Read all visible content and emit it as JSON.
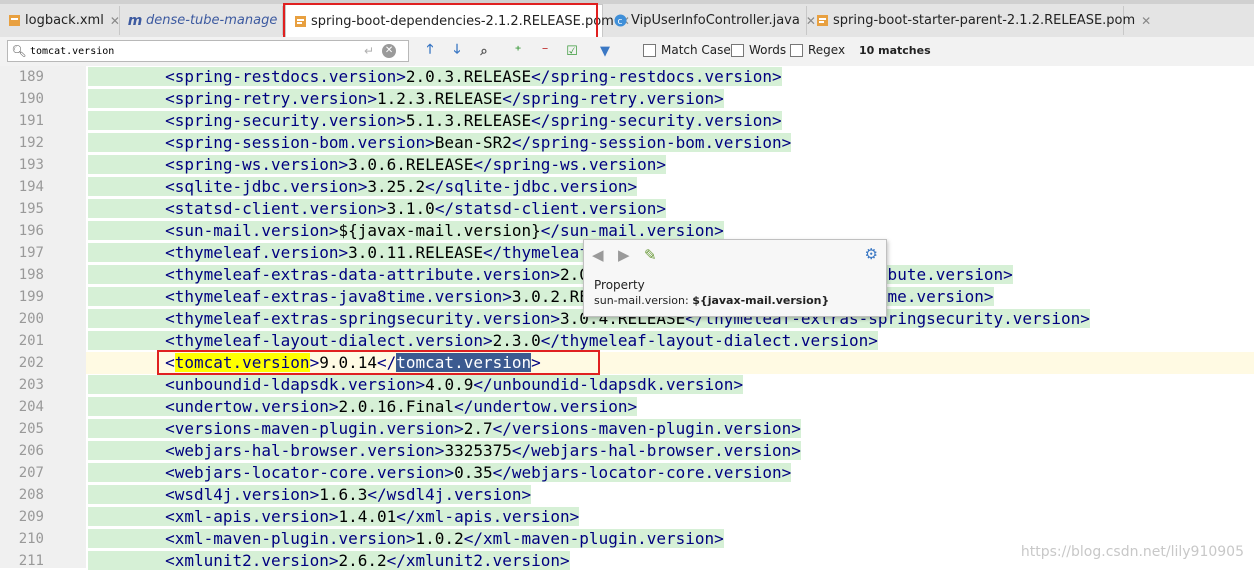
{
  "tabs": [
    {
      "label": "logback.xml",
      "icon": "xml-file-icon",
      "active": false
    },
    {
      "label": "dense-tube-manage",
      "icon": "maven-module-icon",
      "active": false
    },
    {
      "label": "spring-boot-dependencies-2.1.2.RELEASE.pom",
      "icon": "pom-file-icon",
      "active": true
    },
    {
      "label": "VipUserInfoController.java",
      "icon": "java-class-icon",
      "active": false
    },
    {
      "label": "spring-boot-starter-parent-2.1.2.RELEASE.pom",
      "icon": "pom-file-icon",
      "active": false
    }
  ],
  "search": {
    "query": "tomcat.version",
    "match_case_label": "Match Case",
    "words_label": "Words",
    "regex_label": "Regex",
    "match_count": "10 matches"
  },
  "lines": [
    {
      "num": "189",
      "open": "spring-restdocs.version",
      "value": "2.0.3.RELEASE"
    },
    {
      "num": "190",
      "open": "spring-retry.version",
      "value": "1.2.3.RELEASE"
    },
    {
      "num": "191",
      "open": "spring-security.version",
      "value": "5.1.3.RELEASE"
    },
    {
      "num": "192",
      "open": "spring-session-bom.version",
      "value": "Bean-SR2"
    },
    {
      "num": "193",
      "open": "spring-ws.version",
      "value": "3.0.6.RELEASE"
    },
    {
      "num": "194",
      "open": "sqlite-jdbc.version",
      "value": "3.25.2"
    },
    {
      "num": "195",
      "open": "statsd-client.version",
      "value": "3.1.0"
    },
    {
      "num": "196",
      "open": "sun-mail.version",
      "value": "${javax-mail.version}"
    },
    {
      "num": "197",
      "open": "thymeleaf.version",
      "value": "3.0.11.RELEASE"
    },
    {
      "num": "198",
      "open": "thymeleaf-extras-data-attribute.version",
      "value": "2.0.1"
    },
    {
      "num": "199",
      "open": "thymeleaf-extras-java8time.version",
      "value": "3.0.2.RELEASE"
    },
    {
      "num": "200",
      "open": "thymeleaf-extras-springsecurity.version",
      "value": "3.0.4.RELEASE"
    },
    {
      "num": "201",
      "open": "thymeleaf-layout-dialect.version",
      "value": "2.3.0"
    },
    {
      "num": "202",
      "open": "tomcat.version",
      "value": "9.0.14"
    },
    {
      "num": "203",
      "open": "unboundid-ldapsdk.version",
      "value": "4.0.9"
    },
    {
      "num": "204",
      "open": "undertow.version",
      "value": "2.0.16.Final"
    },
    {
      "num": "205",
      "open": "versions-maven-plugin.version",
      "value": "2.7"
    },
    {
      "num": "206",
      "open": "webjars-hal-browser.version",
      "value": "3325375"
    },
    {
      "num": "207",
      "open": "webjars-locator-core.version",
      "value": "0.35"
    },
    {
      "num": "208",
      "open": "wsdl4j.version",
      "value": "1.6.3"
    },
    {
      "num": "209",
      "open": "xml-apis.version",
      "value": "1.4.01"
    },
    {
      "num": "210",
      "open": "xml-maven-plugin.version",
      "value": "1.0.2"
    },
    {
      "num": "211",
      "open": "xmlunit2.version",
      "value": "2.6.2"
    }
  ],
  "current_line": "202",
  "popup": {
    "title": "Property",
    "key": "sun-mail.version:",
    "value": "${javax-mail.version}"
  },
  "watermark": "https://blog.csdn.net/lily910905",
  "colors": {
    "tag": "#000080",
    "line_bg": "#d6f0d6",
    "find_highlight": "#ffff00",
    "selection": "#3c5a90",
    "annotation_box": "#e02020"
  }
}
